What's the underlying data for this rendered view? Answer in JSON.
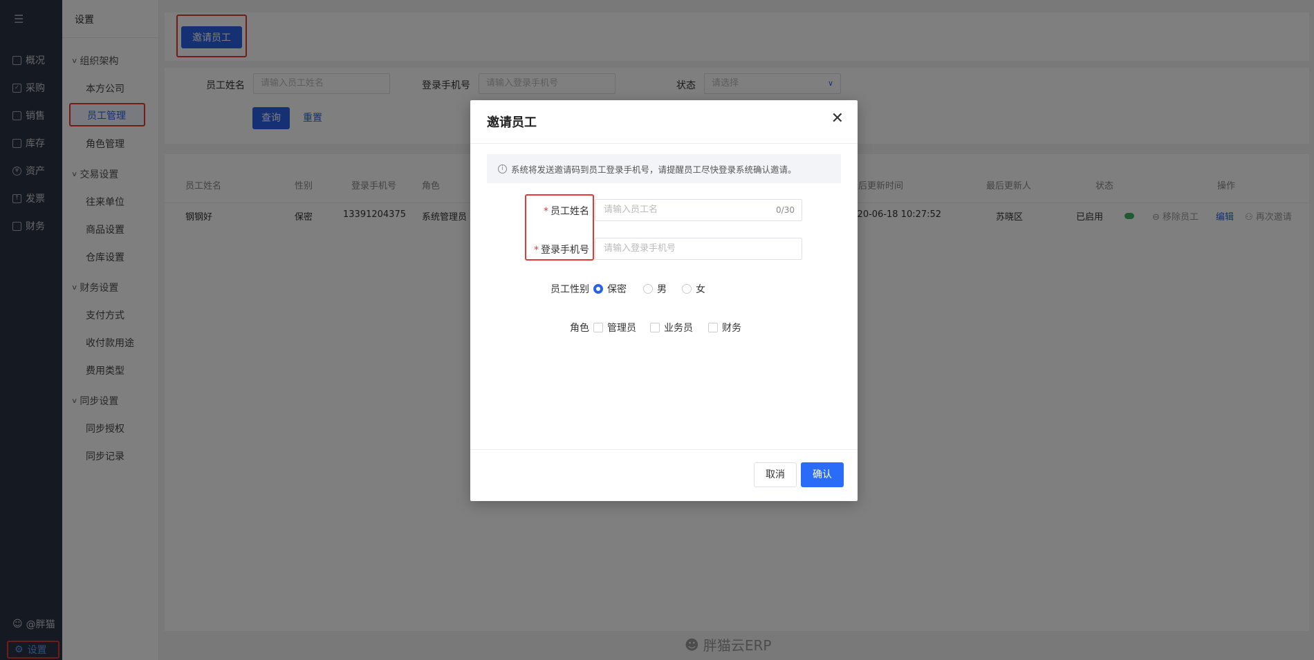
{
  "rail": {
    "items": [
      "概况",
      "采购",
      "销售",
      "库存",
      "资产",
      "发票",
      "财务"
    ],
    "user": "@胖猫",
    "settings": "设置"
  },
  "subnav": {
    "title": "设置",
    "groups": [
      {
        "label": "组织架构",
        "items": [
          "本方公司",
          "员工管理",
          "角色管理"
        ]
      },
      {
        "label": "交易设置",
        "items": [
          "往来单位",
          "商品设置",
          "仓库设置"
        ]
      },
      {
        "label": "财务设置",
        "items": [
          "支付方式",
          "收付款用途",
          "费用类型"
        ]
      },
      {
        "label": "同步设置",
        "items": [
          "同步授权",
          "同步记录"
        ]
      }
    ],
    "active": "员工管理"
  },
  "toolbar": {
    "invite_label": "邀请员工"
  },
  "filters": {
    "name_label": "员工姓名",
    "name_placeholder": "请输入员工姓名",
    "phone_label": "登录手机号",
    "phone_placeholder": "请输入登录手机号",
    "status_label": "状态",
    "status_placeholder": "请选择",
    "query_label": "查询",
    "reset_label": "重置"
  },
  "table": {
    "headers": [
      "员工姓名",
      "性别",
      "登录手机号",
      "角色",
      "最后更新时间",
      "最后更新人",
      "状态",
      "操作"
    ],
    "row": {
      "name": "钢钢好",
      "gender": "保密",
      "phone": "13391204375",
      "role": "系统管理员",
      "updated_at": "2020-06-18 10:27:52",
      "updated_by": "苏晓区",
      "status": "已启用",
      "remove": "移除员工",
      "edit": "编辑",
      "reinvite": "再次邀请"
    }
  },
  "brand": "胖猫云ERP",
  "modal": {
    "title": "邀请员工",
    "notice": "系统将发送邀请码到员工登录手机号，请提醒员工尽快登录系统确认邀请。",
    "name_label": "员工姓名",
    "name_placeholder": "请输入员工名",
    "name_counter": "0/30",
    "phone_label": "登录手机号",
    "phone_placeholder": "请输入登录手机号",
    "gender_label": "员工性别",
    "genders": [
      "保密",
      "男",
      "女"
    ],
    "role_label": "角色",
    "roles": [
      "管理员",
      "业务员",
      "财务"
    ],
    "cancel": "取消",
    "confirm": "确认"
  }
}
